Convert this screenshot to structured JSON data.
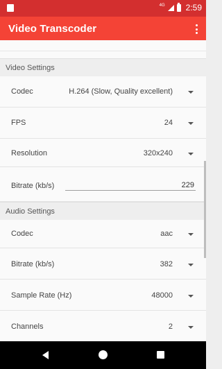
{
  "status_bar": {
    "network": "4G",
    "time": "2:59"
  },
  "app_bar": {
    "title": "Video Transcoder"
  },
  "video_settings": {
    "header": "Video Settings",
    "codec": {
      "label": "Codec",
      "value": "H.264 (Slow, Quality excellent)"
    },
    "fps": {
      "label": "FPS",
      "value": "24"
    },
    "resolution": {
      "label": "Resolution",
      "value": "320x240"
    },
    "bitrate": {
      "label": "Bitrate (kb/s)",
      "value": "229"
    }
  },
  "audio_settings": {
    "header": "Audio Settings",
    "codec": {
      "label": "Codec",
      "value": "aac"
    },
    "bitrate": {
      "label": "Bitrate (kb/s)",
      "value": "382"
    },
    "sample_rate": {
      "label": "Sample Rate (Hz)",
      "value": "48000"
    },
    "channels": {
      "label": "Channels",
      "value": "2"
    }
  },
  "icons": {
    "overflow": "more-vert-icon",
    "back": "back-triangle-icon",
    "home": "home-circle-icon",
    "recent": "recent-square-icon",
    "dropdown": "dropdown-caret-icon"
  },
  "colors": {
    "status_bar": "#d32f2f",
    "app_bar": "#f44336",
    "nav_bar": "#000000"
  }
}
